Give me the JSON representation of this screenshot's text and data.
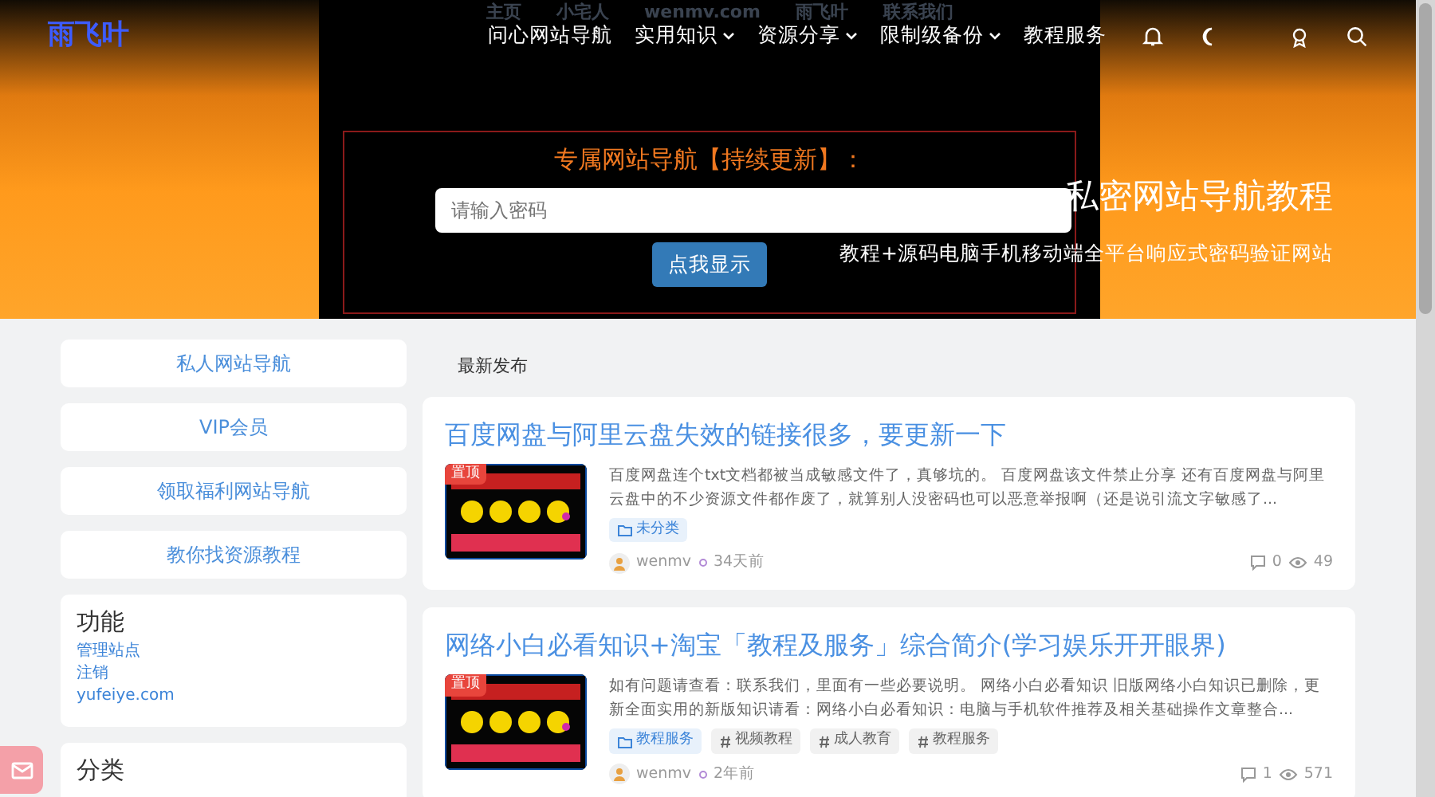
{
  "header": {
    "logo": "雨飞叶",
    "faded_menu": [
      "主页",
      "小宅人",
      "wenmv.com",
      "雨飞叶",
      "联系我们"
    ],
    "nav": [
      {
        "label": "问心网站导航",
        "dropdown": false
      },
      {
        "label": "实用知识",
        "dropdown": true
      },
      {
        "label": "资源分享",
        "dropdown": true
      },
      {
        "label": "限制级备份",
        "dropdown": true
      },
      {
        "label": "教程服务",
        "dropdown": false
      }
    ]
  },
  "banner": {
    "prompt": "专属网站导航【持续更新】：",
    "password_placeholder": "请输入密码",
    "button": "点我显示",
    "title": "私密网站导航教程",
    "subtitle": "教程+源码电脑手机移动端全平台响应式密码验证网站"
  },
  "sidebar": {
    "links": [
      "私人网站导航",
      "VIP会员",
      "领取福利网站导航",
      "教你找资源教程"
    ],
    "widgets": [
      {
        "title": "功能",
        "links": [
          "管理站点",
          "注销",
          "yufeiye.com"
        ]
      },
      {
        "title": "分类"
      }
    ]
  },
  "section_title": "最新发布",
  "posts": [
    {
      "title": "百度网盘与阿里云盘失效的链接很多，要更新一下",
      "badge": "置顶",
      "excerpt": "百度网盘连个txt文档都被当成敏感文件了，真够坑的。 百度网盘该文件禁止分享 还有百度网盘与阿里云盘中的不少资源文件都作废了，就算别人没密码也可以恶意举报啊（还是说引流文字敏感了...",
      "tags": [
        {
          "kind": "category",
          "label": "未分类"
        }
      ],
      "author": "wenmv",
      "time": "34天前",
      "comments": "0",
      "views": "49"
    },
    {
      "title": "网络小白必看知识+淘宝「教程及服务」综合简介(学习娱乐开开眼界)",
      "badge": "置顶",
      "excerpt": "如有问题请查看：联系我们，里面有一些必要说明。 网络小白必看知识 旧版网络小白知识已删除，更新全面实用的新版知识请看：网络小白必看知识：电脑与手机软件推荐及相关基础操作文章整合...",
      "tags": [
        {
          "kind": "category",
          "label": "教程服务"
        },
        {
          "kind": "tag",
          "label": "视频教程"
        },
        {
          "kind": "tag",
          "label": "成人教育"
        },
        {
          "kind": "tag",
          "label": "教程服务"
        }
      ],
      "author": "wenmv",
      "time": "2年前",
      "comments": "1",
      "views": "571"
    }
  ]
}
